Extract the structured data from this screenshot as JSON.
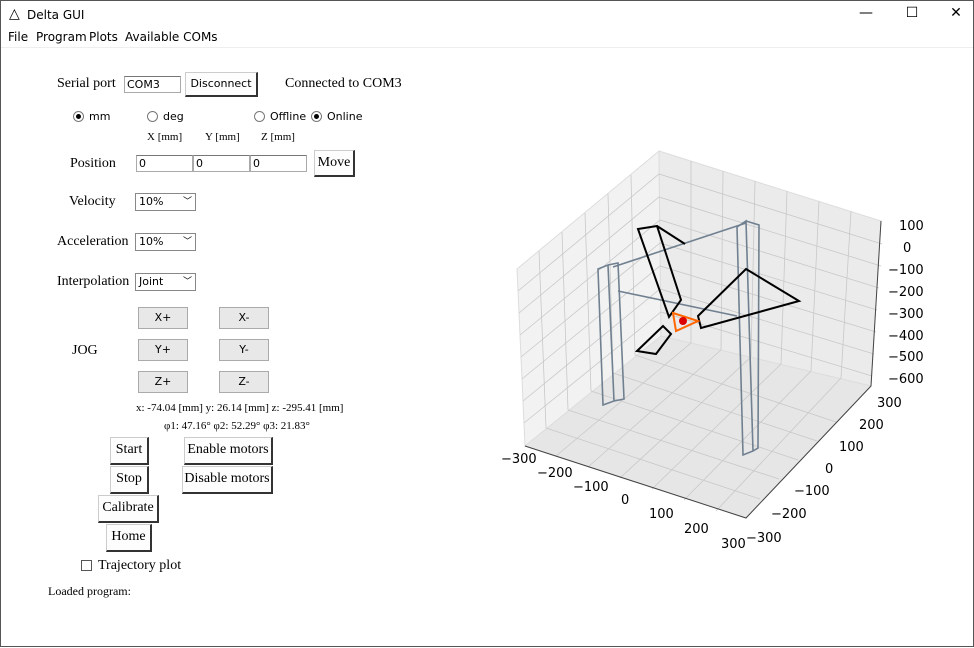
{
  "window": {
    "title": "Delta GUI",
    "minimize": "—",
    "maximize": "☐",
    "close": "✕"
  },
  "menu": [
    "File",
    "Program",
    "Plots",
    "Available COMs"
  ],
  "serial": {
    "label": "Serial port",
    "port_value": "COM3",
    "disconnect": "Disconnect",
    "status": "Connected to COM3"
  },
  "units": {
    "mm": "mm",
    "deg": "deg",
    "selected": "mm"
  },
  "mode": {
    "offline": "Offline",
    "online": "Online",
    "selected": "Online"
  },
  "position": {
    "label": "Position",
    "headers": [
      "X [mm]",
      "Y [mm]",
      "Z [mm]"
    ],
    "values": [
      "0",
      "0",
      "0"
    ],
    "move": "Move"
  },
  "velocity": {
    "label": "Velocity",
    "value": "10%"
  },
  "acceleration": {
    "label": "Acceleration",
    "value": "10%"
  },
  "interpolation": {
    "label": "Interpolation",
    "value": "Joint"
  },
  "jog": {
    "label": "JOG",
    "buttons": [
      "X+",
      "X-",
      "Y+",
      "Y-",
      "Z+",
      "Z-"
    ]
  },
  "readout": {
    "xyz": "x: -74.04 [mm] y: 26.14 [mm] z: -295.41 [mm]",
    "angles": "φ1: 47.16° φ2: 52.29° φ3: 21.83°"
  },
  "buttons": {
    "start": "Start",
    "stop": "Stop",
    "calibrate": "Calibrate",
    "home": "Home",
    "enable": "Enable motors",
    "disable": "Disable motors"
  },
  "trajectory": {
    "label": "Trajectory plot",
    "checked": false
  },
  "loaded_program": "Loaded program:",
  "plot": {
    "x_ticks": [
      "−300",
      "−200",
      "−100",
      "0",
      "100",
      "200",
      "300"
    ],
    "y_ticks": [
      "300",
      "200",
      "100",
      "0",
      "−100",
      "−200",
      "−300"
    ],
    "z_ticks": [
      "100",
      "0",
      "−100",
      "−200",
      "−300",
      "−400",
      "−500",
      "−600"
    ],
    "colors": {
      "frame": "#708090",
      "arm": "#000000",
      "effector": "#ff6600",
      "point": "#dd0000"
    }
  }
}
